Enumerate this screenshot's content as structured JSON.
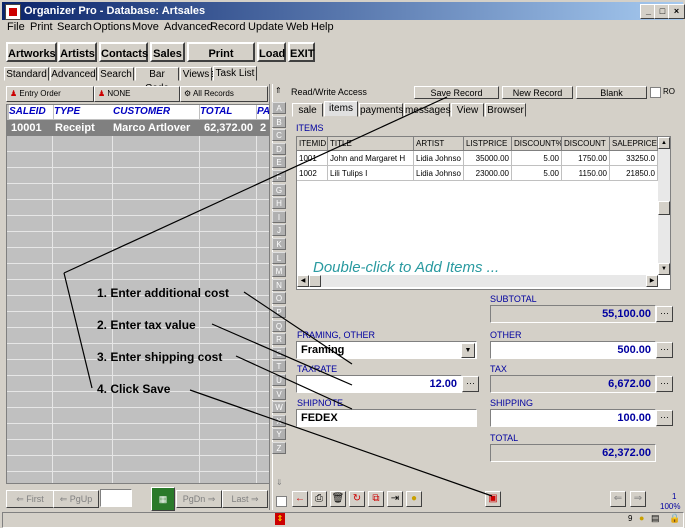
{
  "window": {
    "title": "Organizer Pro - Database: Artsales"
  },
  "menu": [
    "File",
    "Print",
    "Search",
    "Options",
    "Move",
    "Advanced",
    "Record",
    "Update",
    "Web",
    "Help"
  ],
  "toolbar": [
    "Artworks",
    "Artists",
    "Contacts",
    "Sales",
    "Print Receipt",
    "Load",
    "EXIT"
  ],
  "view_tabs": [
    "Standard",
    "Advanced",
    "Search",
    "Bar Code",
    "Views",
    "Task List"
  ],
  "left_toolbar": {
    "entry_order": "Entry Order",
    "filter": "NONE",
    "records": "All Records"
  },
  "list": {
    "columns": [
      "SALEID",
      "TYPE",
      "CUSTOMER",
      "TOTAL",
      "PA"
    ],
    "rows": [
      [
        "10001",
        "Receipt",
        "Marco Artlover",
        "62,372.00",
        "2"
      ]
    ]
  },
  "left_nav": {
    "first": "First",
    "pgup": "PgUp",
    "pgdn": "PgDn",
    "last": "Last"
  },
  "access_label": "Read/Write Access",
  "record_buttons": {
    "save": "Save Record",
    "new": "New Record",
    "blank": "Blank",
    "ro": "RO"
  },
  "letters": [
    "A",
    "B",
    "C",
    "D",
    "E",
    "F",
    "G",
    "H",
    "I",
    "J",
    "K",
    "L",
    "M",
    "N",
    "O",
    "P",
    "Q",
    "R",
    "S",
    "T",
    "U",
    "V",
    "W",
    "X",
    "Y",
    "Z"
  ],
  "form_tabs": [
    "sale",
    "items",
    "payments",
    "messages",
    "View",
    "Browser"
  ],
  "items": {
    "label": "ITEMS",
    "columns": [
      "ITEMID",
      "TITLE",
      "ARTIST",
      "LISTPRICE",
      "DISCOUNT%",
      "DISCOUNT",
      "SALEPRICE"
    ],
    "rows": [
      [
        "1001",
        "John and Margaret H",
        "Lidia Johnso",
        "35000.00",
        "5.00",
        "1750.00",
        "33250.0"
      ],
      [
        "1002",
        "Lili Tulips I",
        "Lidia Johnso",
        "23000.00",
        "5.00",
        "1150.00",
        "21850.0"
      ]
    ],
    "hint": "Double-click to Add Items ..."
  },
  "fields": {
    "subtotal": {
      "label": "SUBTOTAL",
      "value": "55,100.00"
    },
    "framing_other": {
      "label": "FRAMING, OTHER",
      "value": "Framing"
    },
    "other": {
      "label": "OTHER",
      "value": "500.00"
    },
    "taxrate": {
      "label": "TAXRATE",
      "value": "12.00"
    },
    "tax": {
      "label": "TAX",
      "value": "6,672.00"
    },
    "shipnote": {
      "label": "SHIPNOTE",
      "value": "FEDEX"
    },
    "shipping": {
      "label": "SHIPPING",
      "value": "100.00"
    },
    "total": {
      "label": "TOTAL",
      "value": "62,372.00"
    }
  },
  "annotations": [
    "1. Enter additional cost",
    "2. Enter tax value",
    "3. Enter shipping cost",
    "4. Click Save"
  ],
  "status": {
    "record": "1",
    "zoom": "100%",
    "counter": "9"
  }
}
